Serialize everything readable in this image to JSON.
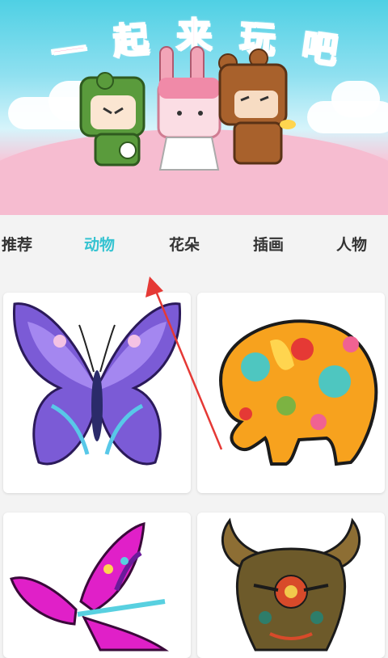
{
  "banner": {
    "title_chars": [
      "一",
      "起",
      "来",
      "玩",
      "吧"
    ]
  },
  "tabs": [
    {
      "label": "推荐",
      "active": false
    },
    {
      "label": "动物",
      "active": true
    },
    {
      "label": "花朵",
      "active": false
    },
    {
      "label": "插画",
      "active": false
    },
    {
      "label": "人物",
      "active": false
    }
  ],
  "colors": {
    "accent": "#35c3d1",
    "annotation_arrow": "#e53935",
    "title_pink": "#ff5fa2"
  },
  "grid": {
    "cards": [
      {
        "subject": "butterfly-purple"
      },
      {
        "subject": "elephant-orange"
      },
      {
        "subject": "butterfly-pink"
      },
      {
        "subject": "bull-head"
      }
    ]
  }
}
